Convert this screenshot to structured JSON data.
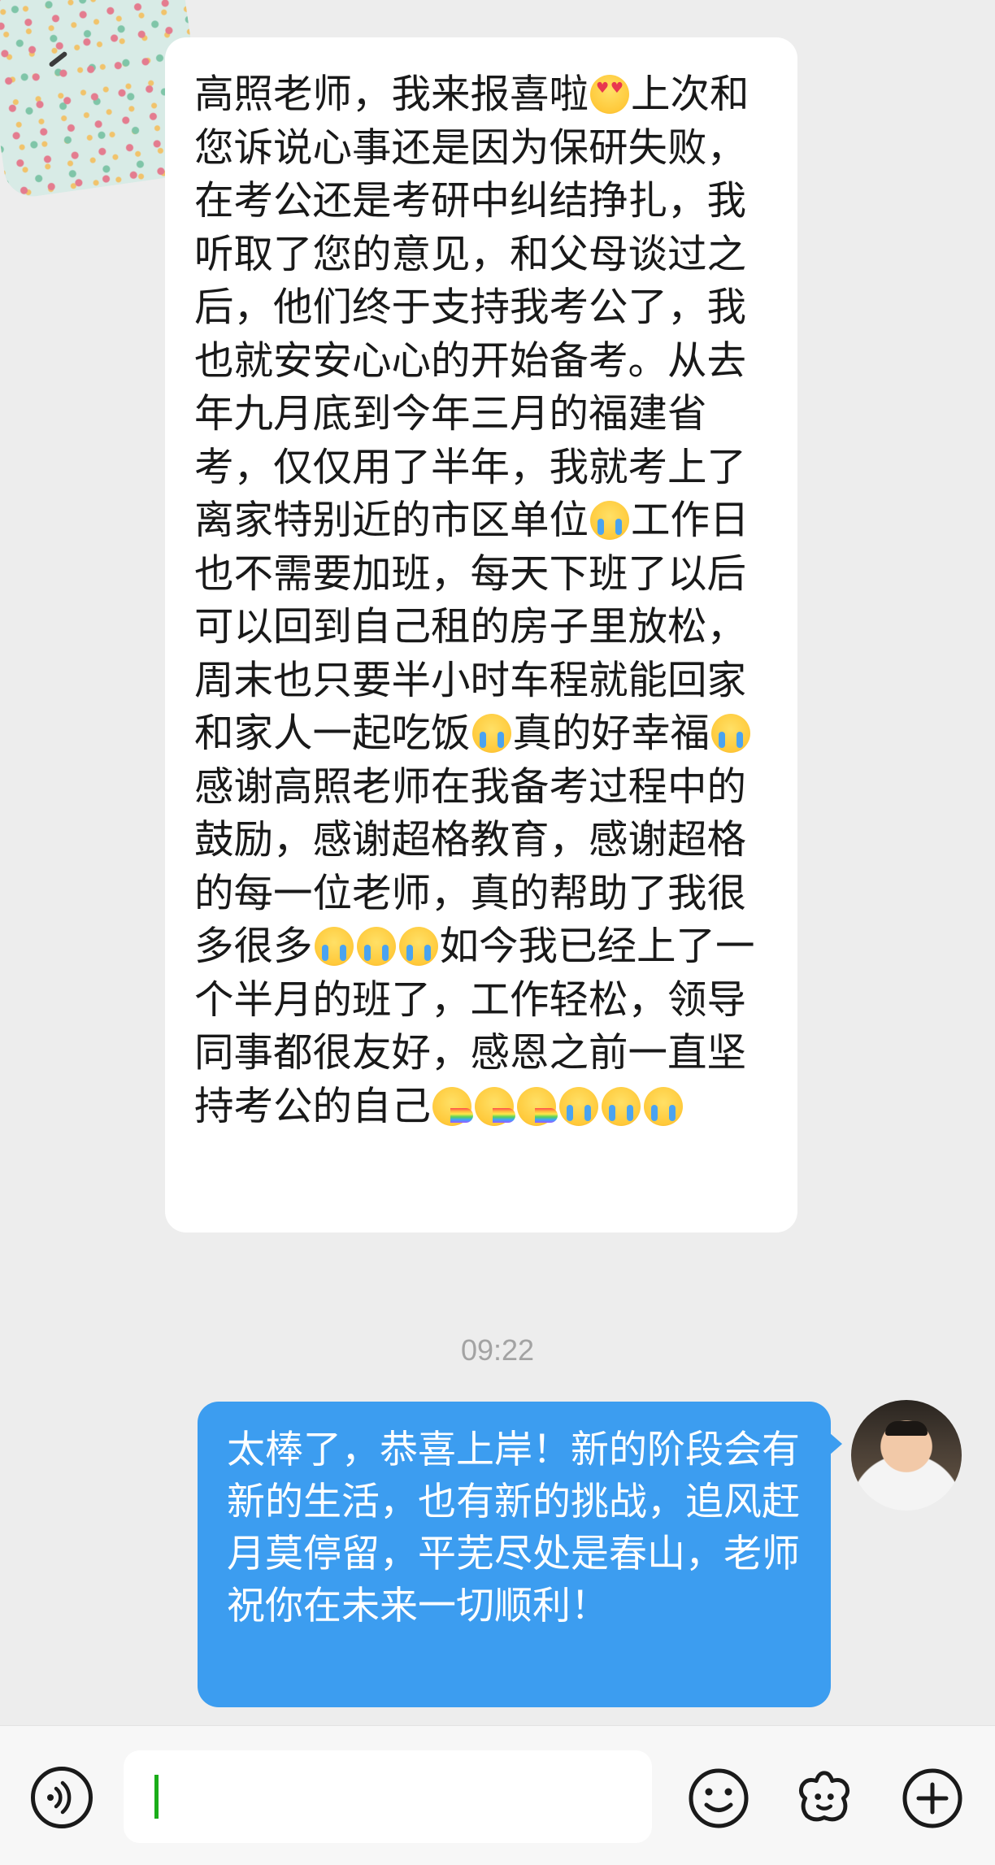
{
  "conversation": {
    "incoming_message": "高照老师，我来报喜啦😍上次和您诉说心事还是因为保研失败，在考公还是考研中纠结挣扎，我听取了您的意见，和父母谈过之后，他们终于支持我考公了，我也就安安心心的开始备考。从去年九月底到今年三月的福建省考，仅仅用了半年，我就考上了离家特别近的市区单位😭工作日也不需要加班，每天下班了以后可以回到自己租的房子里放松，周末也只要半小时车程就能回家和家人一起吃饭😭真的好幸福😭感谢高照老师在我备考过程中的鼓励，感谢超格教育，感谢超格的每一位老师，真的帮助了我很多很多😭😭😭如今我已经上了一个半月的班了，工作轻松，领导同事都很友好，感恩之前一直坚持考公的自己🥳🥳🥳😭😭😭",
    "incoming_segments": [
      {
        "t": "高照老师，我来报喜啦"
      },
      {
        "e": "love"
      },
      {
        "t": "上次和您诉说心事还是因为保研失败，在考公还是考研中纠结挣扎，我听取了您的意见，和父母谈过之后，他们终于支持我考公了，我也就安安心心的开始备考。从去年九月底到今年三月的福建省考，仅仅用了半年，我就考上了离家特别近的市区单位"
      },
      {
        "e": "cry"
      },
      {
        "t": "工作日也不需要加班，每天下班了以后可以回到自己租的房子里放松，周末也只要半小时车程就能回家和家人一起吃饭"
      },
      {
        "e": "cry"
      },
      {
        "t": "真的好幸福"
      },
      {
        "e": "cry"
      },
      {
        "t": "感谢高照老师在我备考过程中的鼓励，感谢超格教育，感谢超格的每一位老师，真的帮助了我很多很多"
      },
      {
        "e": "cry"
      },
      {
        "e": "cry"
      },
      {
        "e": "cry"
      },
      {
        "t": "如今我已经上了一个半月的班了，工作轻松，领导同事都很友好，感恩之前一直坚持考公的自己"
      },
      {
        "e": "rainbow"
      },
      {
        "e": "rainbow"
      },
      {
        "e": "rainbow"
      },
      {
        "e": "cry"
      },
      {
        "e": "cry"
      },
      {
        "e": "cry"
      }
    ],
    "timestamp": "09:22",
    "outgoing_message": "太棒了，恭喜上岸！新的阶段会有新的生活，也有新的挑战，追风赶月莫停留，平芜尽处是春山，老师祝你在未来一切顺利！"
  },
  "input_bar": {
    "input_value": "",
    "icons": {
      "voice": "voice-icon",
      "emoji": "emoji-icon",
      "sticker": "sticker-icon",
      "more": "plus-icon"
    }
  },
  "colors": {
    "background": "#ededed",
    "incoming_bubble": "#ffffff",
    "outgoing_bubble": "#3c9df0",
    "caret": "#1aad19"
  }
}
